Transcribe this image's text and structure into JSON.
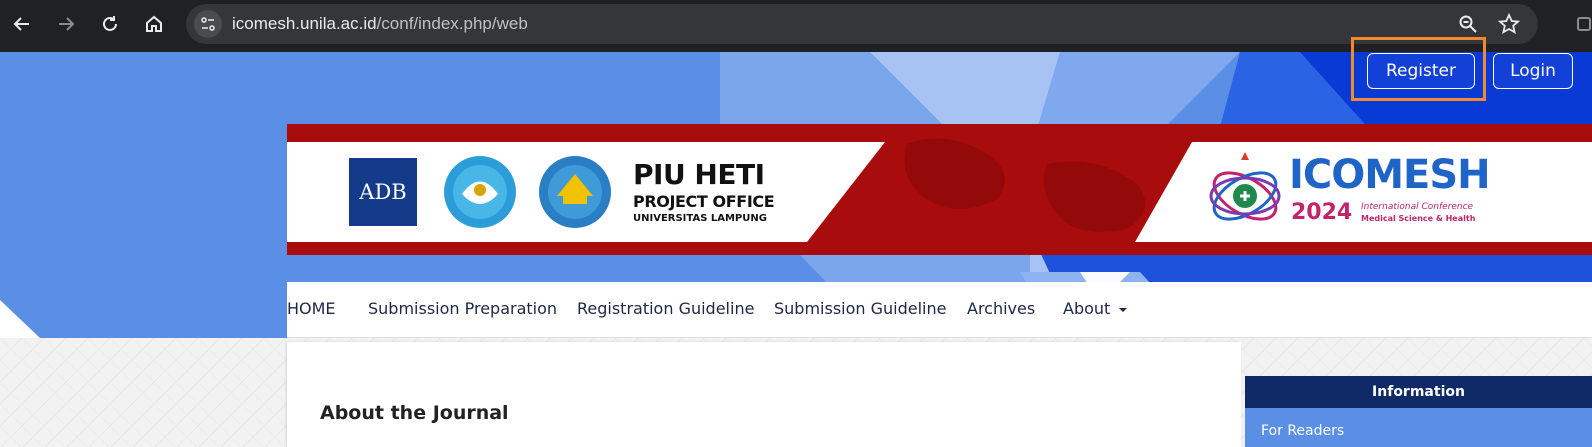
{
  "browser": {
    "url_host": "icomesh.unila.ac.id",
    "url_path": "/conf/index.php/web",
    "icons": [
      "back-arrow-icon",
      "forward-arrow-icon",
      "reload-icon",
      "home-icon",
      "site-info-icon",
      "zoom-icon",
      "bookmark-star-icon"
    ]
  },
  "user_menu": {
    "register_label": "Register",
    "login_label": "Login"
  },
  "banner": {
    "adb_logo": "ADB",
    "piu_title": "PIU HETI",
    "piu_subtitle": "PROJECT OFFICE",
    "piu_univ": "UNIVERSITAS LAMPUNG",
    "event_logo": "ICOMESH",
    "event_year": "2024",
    "event_tagline_1": "International Conference",
    "event_tagline_2": "Medical Science & Health"
  },
  "nav": {
    "items": [
      {
        "label": "HOME"
      },
      {
        "label": "Submission Preparation"
      },
      {
        "label": "Registration Guideline"
      },
      {
        "label": "Submission Guideline"
      },
      {
        "label": "Archives"
      },
      {
        "label": "About"
      }
    ]
  },
  "main": {
    "heading": "About the Journal"
  },
  "sidebar": {
    "title": "Information",
    "links": [
      {
        "label": "For Readers"
      }
    ]
  },
  "colors": {
    "accent_blue": "#5b8fe6",
    "dark_navy": "#0f2a66",
    "banner_red": "#a80c0c",
    "highlight_orange": "#f08a2c"
  }
}
